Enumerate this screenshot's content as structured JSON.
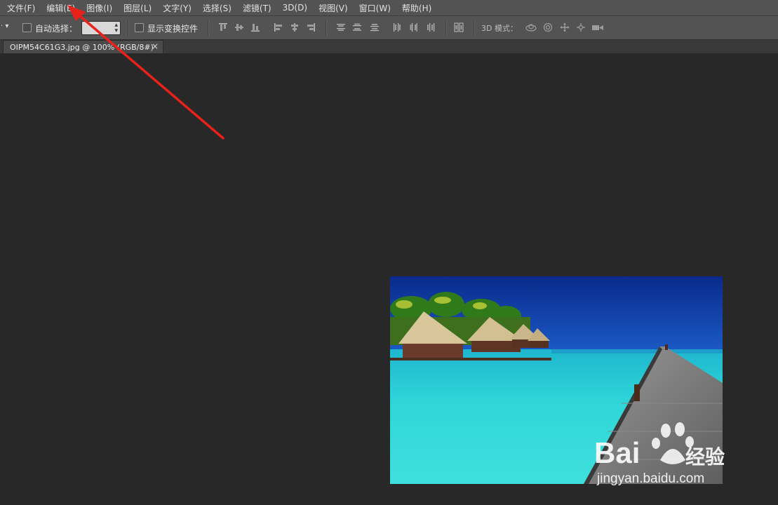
{
  "menu": {
    "items": [
      "文件(F)",
      "编辑(E)",
      "图像(I)",
      "图层(L)",
      "文字(Y)",
      "选择(S)",
      "滤镜(T)",
      "3D(D)",
      "视图(V)",
      "窗口(W)",
      "帮助(H)"
    ]
  },
  "options": {
    "auto_select_label": "自动选择：",
    "show_transform_label": "显示变换控件",
    "mode_3d_label": "3D 模式："
  },
  "document": {
    "tab_title": "OIPM54C61G3.jpg @ 100% (RGB/8#)",
    "close_glyph": "×"
  },
  "watermark": {
    "brand": "Bai",
    "brand_cn": "经验",
    "url": "jingyan.baidu.com"
  },
  "colors": {
    "annotation_arrow": "#e8221b"
  }
}
